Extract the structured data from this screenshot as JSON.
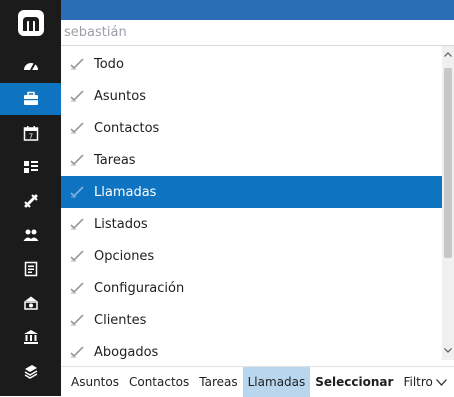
{
  "search": {
    "value": "sebastián",
    "placeholder": ""
  },
  "sidebar": {
    "items": [
      {
        "icon": "dashboard-icon",
        "active": false
      },
      {
        "icon": "briefcase-icon",
        "active": true
      },
      {
        "icon": "calendar-icon",
        "active": false
      },
      {
        "icon": "list-view-icon",
        "active": false
      },
      {
        "icon": "phone-icon",
        "active": false
      },
      {
        "icon": "people-icon",
        "active": false
      },
      {
        "icon": "document-icon",
        "active": false
      },
      {
        "icon": "money-icon",
        "active": false
      },
      {
        "icon": "bank-icon",
        "active": false
      },
      {
        "icon": "layers-icon",
        "active": false
      }
    ]
  },
  "list": {
    "items": [
      {
        "label": "Todo",
        "selected": false
      },
      {
        "label": "Asuntos",
        "selected": false
      },
      {
        "label": "Contactos",
        "selected": false
      },
      {
        "label": "Tareas",
        "selected": false
      },
      {
        "label": "Llamadas",
        "selected": true
      },
      {
        "label": "Listados",
        "selected": false
      },
      {
        "label": "Opciones",
        "selected": false
      },
      {
        "label": "Configuración",
        "selected": false
      },
      {
        "label": "Clientes",
        "selected": false
      },
      {
        "label": "Abogados",
        "selected": false
      }
    ]
  },
  "tabs": {
    "items": [
      {
        "label": "Asuntos"
      },
      {
        "label": "Contactos"
      },
      {
        "label": "Tareas"
      },
      {
        "label": "Llamadas",
        "active": true
      },
      {
        "label": "Seleccionar",
        "bold": true
      },
      {
        "label": "Filtro"
      }
    ]
  },
  "colors": {
    "sidebar_bg": "#1b1b1b",
    "accent": "#0e73c0",
    "tab_active": "#b9d6ef"
  }
}
